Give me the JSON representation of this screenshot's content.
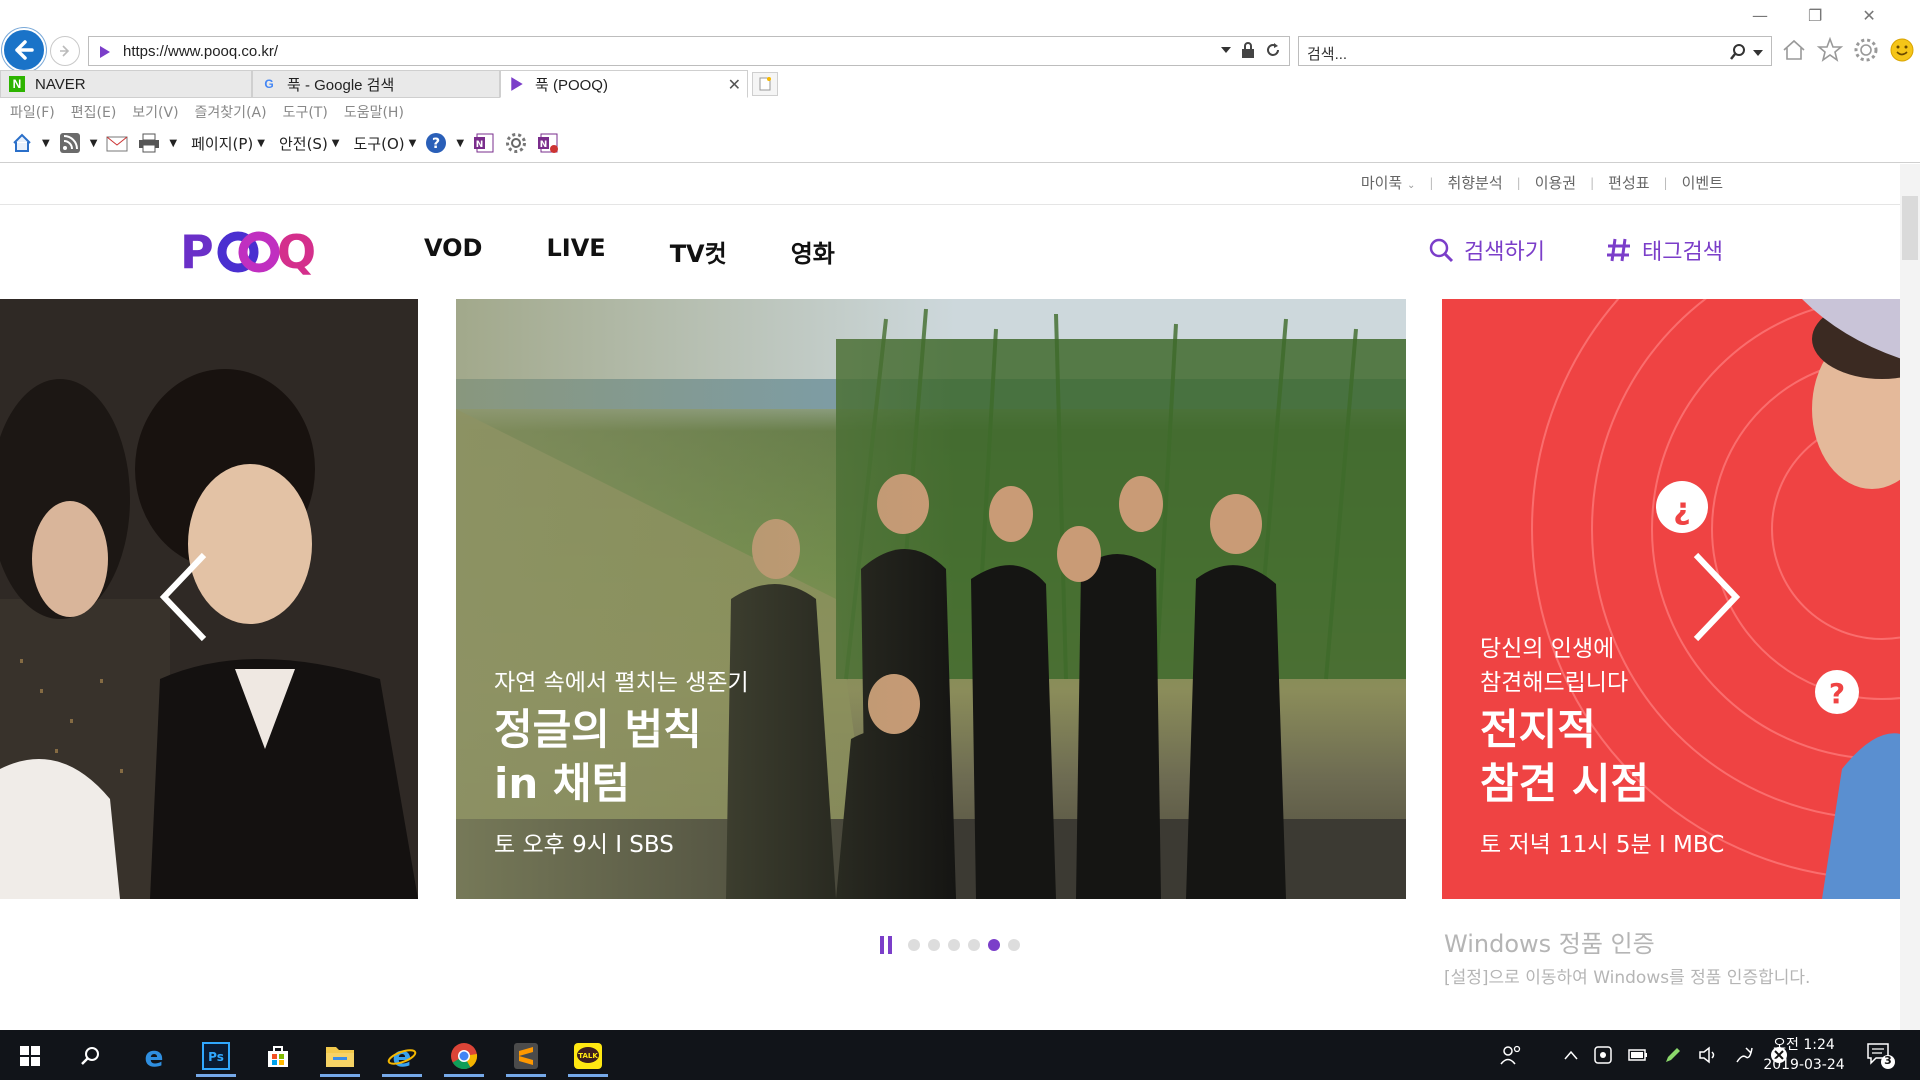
{
  "browser": {
    "url": "https://www.pooq.co.kr/",
    "search_placeholder": "검색...",
    "tabs": [
      {
        "label": "NAVER",
        "favicon": "naver-icon",
        "favicon_color": "#2db400"
      },
      {
        "label": "푹 - Google 검색",
        "favicon": "google-icon"
      },
      {
        "label": "푹 (POOQ)",
        "favicon": "pooq-play-icon",
        "active": true
      }
    ],
    "menu": [
      "파일(F)",
      "편집(E)",
      "보기(V)",
      "즐겨찾기(A)",
      "도구(T)",
      "도움말(H)"
    ],
    "command_bar": {
      "page": "페이지(P)",
      "safety": "안전(S)",
      "tools": "도구(O)"
    }
  },
  "site": {
    "util_links": [
      "마이푹",
      "취향분석",
      "이용권",
      "편성표",
      "이벤트"
    ],
    "logo": "POOQ",
    "nav": [
      "VOD",
      "LIVE",
      "TV컷",
      "영화"
    ],
    "search_label": "검색하기",
    "tag_search_label": "태그검색",
    "accent": "#7b3ec9"
  },
  "carousel": {
    "slides": [
      {
        "type": "drama-poster"
      },
      {
        "subtitle": "자연 속에서 펼치는 생존기",
        "title_line1": "정글의 법칙",
        "title_line2": "in 채텀",
        "meta": "토 오후 9시 I SBS"
      },
      {
        "subtitle_line1": "당신의 인생에",
        "subtitle_line2": "참견해드립니다",
        "title_line1": "전지적",
        "title_line2": "참견 시점",
        "meta": "토 저녁 11시 5분 I MBC",
        "background": "#ef4343"
      }
    ],
    "pager": {
      "total": 6,
      "active_index": 4,
      "paused": true
    }
  },
  "watermark": {
    "title": "Windows 정품 인증",
    "subtitle": "[설정]으로 이동하여 Windows를 정품 인증합니다."
  },
  "taskbar": {
    "apps": [
      "windows-start-icon",
      "search-icon",
      "edge-icon",
      "photoshop-icon",
      "store-icon",
      "file-explorer-icon",
      "ie-icon",
      "chrome-icon",
      "sublime-icon",
      "kakaotalk-icon"
    ],
    "clock_time": "오전 1:24",
    "clock_date": "2019-03-24",
    "notification_count": "3"
  }
}
